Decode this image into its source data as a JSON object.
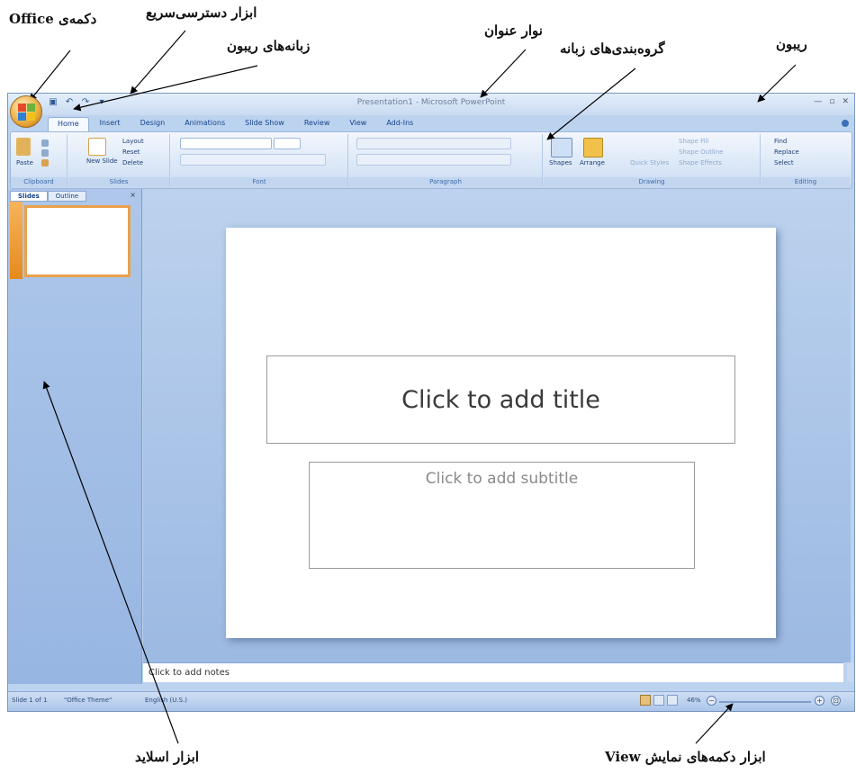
{
  "annotations": {
    "office_button": "دکمه‌ی Office",
    "quick_access": "ابزار دسترسی‌سریع",
    "ribbon_tabs": "زبانه‌های ریبون",
    "title_bar": "نوار عنوان",
    "tab_groups": "گروه‌بندی‌های زبانه",
    "ribbon": "ریبون",
    "slides_tool": "ابزار اسلاید",
    "view_buttons": "ابزار دکمه‌های نمایش View"
  },
  "window": {
    "title": "Presentation1 - Microsoft PowerPoint",
    "tabs": [
      "Home",
      "Insert",
      "Design",
      "Animations",
      "Slide Show",
      "Review",
      "View",
      "Add-Ins"
    ],
    "active_tab": "Home"
  },
  "ribbon": {
    "groups": {
      "clipboard": "Clipboard",
      "slides": "Slides",
      "font": "Font",
      "paragraph": "Paragraph",
      "drawing": "Drawing",
      "editing": "Editing"
    },
    "buttons": {
      "paste": "Paste",
      "new_slide": "New Slide",
      "layout": "Layout",
      "reset": "Reset",
      "delete": "Delete",
      "shapes": "Shapes",
      "arrange": "Arrange",
      "quick_styles": "Quick Styles",
      "shape_fill": "Shape Fill",
      "shape_outline": "Shape Outline",
      "shape_effects": "Shape Effects",
      "find": "Find",
      "replace": "Replace",
      "select": "Select"
    }
  },
  "pane": {
    "tab_slides": "Slides",
    "tab_outline": "Outline",
    "close": "×"
  },
  "slide": {
    "title_placeholder": "Click to add title",
    "subtitle_placeholder": "Click to add subtitle"
  },
  "notes": "Click to add notes",
  "status": {
    "slide_count": "Slide 1 of 1",
    "theme": "\"Office Theme\"",
    "language": "English (U.S.)",
    "zoom": "46%"
  },
  "colors": {
    "ribbon_blue": "#c4d7f0",
    "office_orange": "#e9a93a",
    "accent_text": "#15428b"
  }
}
